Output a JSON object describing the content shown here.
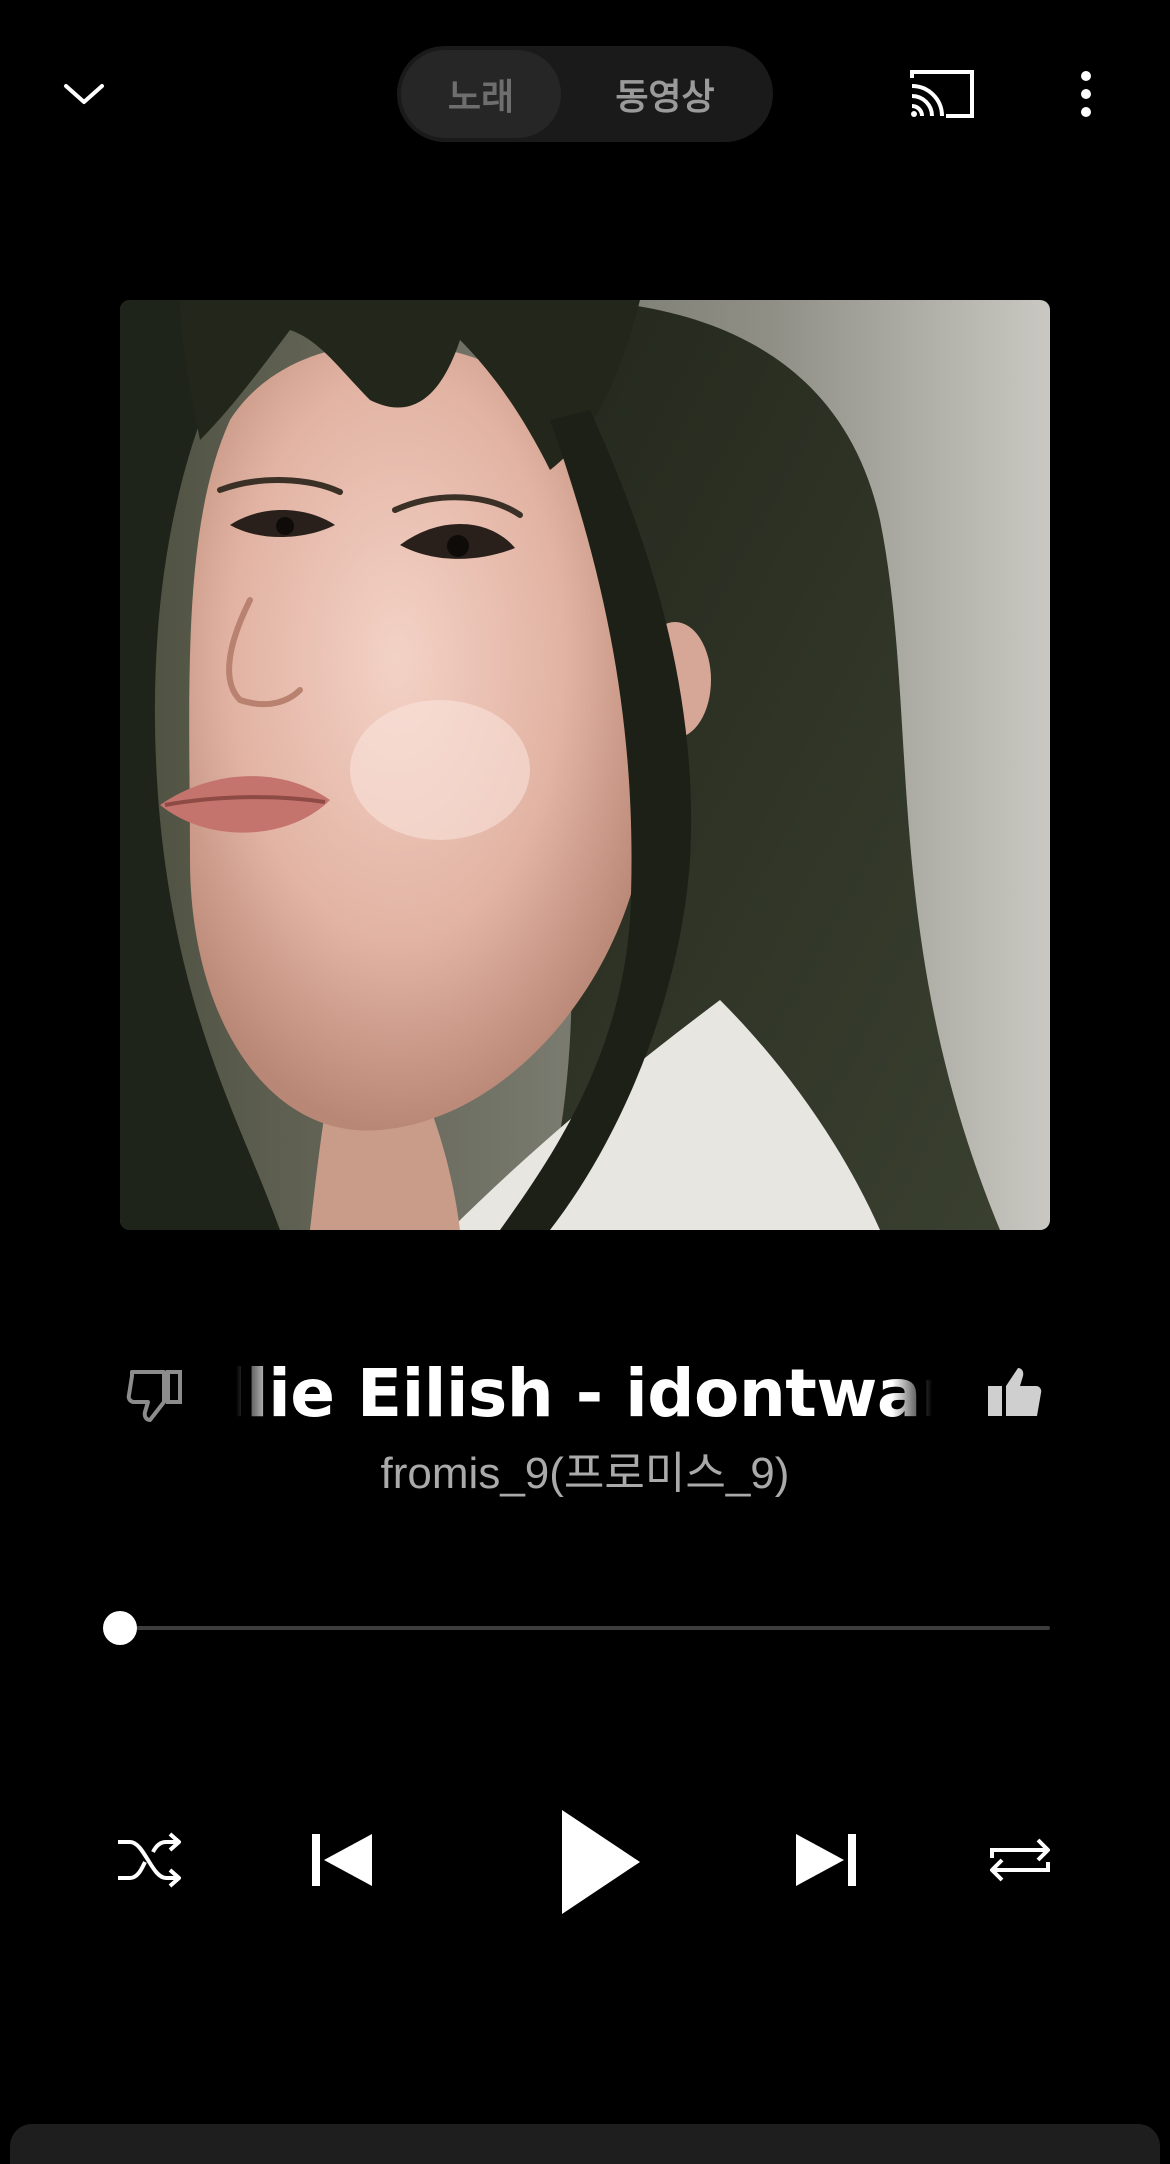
{
  "header": {
    "collapse_icon": "chevron-down-icon",
    "tabs": [
      {
        "label": "노래",
        "selected": true
      },
      {
        "label": "동영상",
        "selected": false
      }
    ],
    "cast_icon": "cast-icon",
    "more_icon": "more-vertical-icon"
  },
  "now_playing": {
    "title": "Billie Eilish - idontwannabeyouanymore",
    "artist": "fromis_9(프로미스_9)",
    "dislike_icon": "thumb-down-icon",
    "like_icon": "thumb-up-icon",
    "liked": true
  },
  "progress": {
    "fraction": 0.0
  },
  "controls": {
    "shuffle_icon": "shuffle-icon",
    "previous_icon": "skip-previous-icon",
    "play_icon": "play-icon",
    "next_icon": "skip-next-icon",
    "repeat_icon": "repeat-icon"
  },
  "colors": {
    "background": "#000000",
    "foreground": "#ffffff",
    "secondary_text": "#aaaaaa",
    "track": "#3d3d3d"
  }
}
